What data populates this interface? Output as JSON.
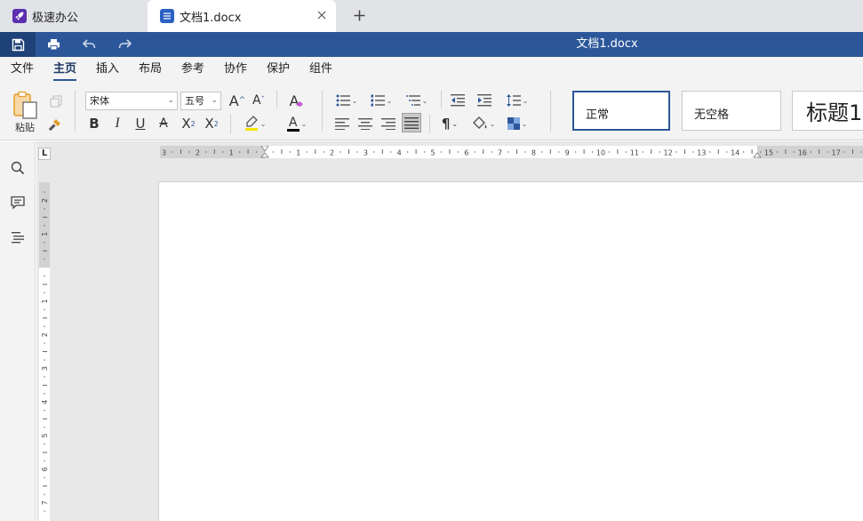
{
  "tabs": [
    {
      "label": "极速办公",
      "icon": "rocket-icon",
      "active": false,
      "icon_color": "#5b2fb0"
    },
    {
      "label": "文档1.docx",
      "icon": "document-icon",
      "active": true,
      "icon_color": "#2b62c4"
    }
  ],
  "titlebar": {
    "title": "文档1.docx",
    "accent_color": "#2b579a",
    "quick_access": [
      "save-icon",
      "print-icon",
      "undo-icon",
      "redo-icon"
    ]
  },
  "menu": [
    {
      "label": "文件",
      "active": false
    },
    {
      "label": "主页",
      "active": true
    },
    {
      "label": "插入",
      "active": false
    },
    {
      "label": "布局",
      "active": false
    },
    {
      "label": "参考",
      "active": false
    },
    {
      "label": "协作",
      "active": false
    },
    {
      "label": "保护",
      "active": false
    },
    {
      "label": "组件",
      "active": false
    }
  ],
  "ribbon": {
    "paste_label": "粘贴",
    "font_name": "宋体",
    "font_size": "五号",
    "format_buttons": {
      "bold": "B",
      "italic": "I",
      "underline": "U",
      "strike": "A",
      "superscript": "X",
      "subscript": "X",
      "clear_format": "A",
      "grow": "A",
      "shrink": "A",
      "font_color": "A"
    },
    "styles": [
      {
        "label": "正常",
        "selected": true
      },
      {
        "label": "无空格",
        "selected": false
      },
      {
        "label": "标题1",
        "selected": false
      }
    ]
  },
  "sidebar": {
    "icons": [
      "search-icon",
      "comment-icon",
      "navigation-icon"
    ]
  },
  "ruler": {
    "corner_label": "L",
    "horizontal_labels": [
      "3",
      "2",
      "1",
      "1",
      "2",
      "3",
      "4",
      "5",
      "6",
      "7",
      "8",
      "9",
      "10",
      "11",
      "12",
      "13",
      "14",
      "15",
      "16",
      "17"
    ],
    "vertical_labels": [
      "2",
      "1",
      "1",
      "2",
      "3",
      "4",
      "5",
      "6",
      "7"
    ]
  }
}
